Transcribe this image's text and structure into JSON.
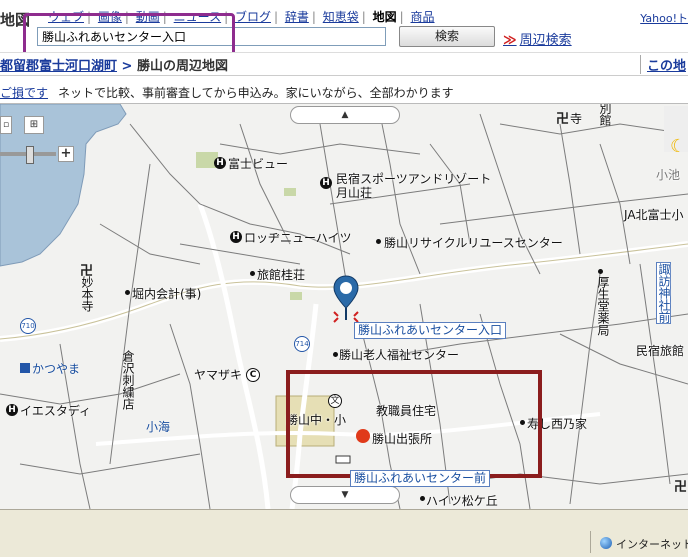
{
  "header": {
    "site_title": "地図",
    "nav": [
      {
        "label": "ウェブ",
        "active": false
      },
      {
        "label": "画像",
        "active": false
      },
      {
        "label": "動画",
        "active": false
      },
      {
        "label": "ニュース",
        "active": false
      },
      {
        "label": "ブログ",
        "active": false
      },
      {
        "label": "辞書",
        "active": false
      },
      {
        "label": "知恵袋",
        "active": false
      },
      {
        "label": "地図",
        "active": true
      },
      {
        "label": "商品",
        "active": false
      }
    ],
    "yahoo_link": "Yahoo!ト",
    "search_value": "勝山ふれあいセンター入口",
    "search_button": "検索",
    "nearby_link": "周辺検索",
    "nearby_arrows": "≫"
  },
  "breadcrumb": {
    "items": [
      "都留郡富士河口湖町",
      "勝山の周辺地図"
    ],
    "separator": ">",
    "map_link": "この地"
  },
  "ad": {
    "link": "ご損です",
    "text": "ネットで比較、事前審査してから申込み。家にいながら、全部わかります"
  },
  "map": {
    "labels": {
      "fujiview": "富士ビュー",
      "minshuku_sports": "民宿スポーツアンドリゾート",
      "gekkousou": "月山荘",
      "lodge": "ロッヂニューハイツ",
      "recycle": "勝山リサイクルリユースセンター",
      "ryokan": "旅館桂荘",
      "kaikei": "堀内会計(事)",
      "myomoto": "妙本寺",
      "kurasawa": "倉沢刺繍店",
      "yamazaki": "ヤマザキ",
      "katsuyama_rojin": "勝山老人福祉センター",
      "katsuyama_school": "勝山中・小",
      "kyoin": "教職員住宅",
      "shutchojo": "勝山出張所",
      "kotobuki": "寿し西乃家",
      "kouseido": "厚生堂薬局",
      "minshuku_ryokan": "民宿旅館",
      "ja": "JA北富士小",
      "suwa": "諏訪神社前",
      "hait": "ハイツ松ケ丘",
      "betsukan": "別館",
      "tera": "寺",
      "koike": "小池",
      "kaze": "かつやま",
      "esutadi": "イエスタディ",
      "koumi": "小海",
      "route_710": "710",
      "route_714": "714"
    },
    "markers": {
      "target": "勝山ふれあいセンター入口",
      "bus_stop": "勝山ふれあいセンター前"
    }
  },
  "status_bar": {
    "zone": "インターネット"
  }
}
